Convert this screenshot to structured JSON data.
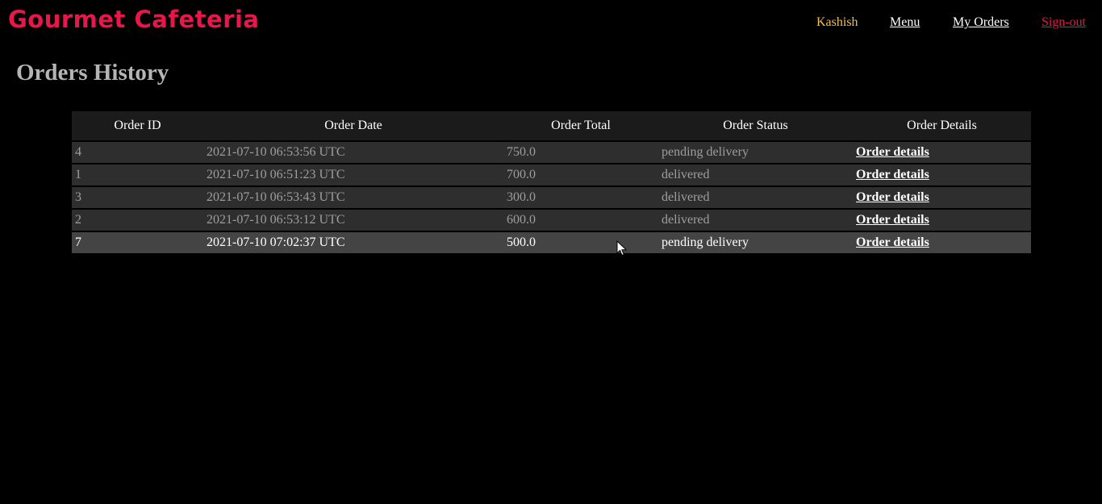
{
  "header": {
    "brand": "Gourmet Cafeteria",
    "nav": {
      "user": "Kashish",
      "menu": "Menu",
      "my_orders": "My Orders",
      "signout": "Sign-out"
    }
  },
  "page": {
    "title": "Orders History"
  },
  "table": {
    "headers": [
      "Order ID",
      "Order Date",
      "Order Total",
      "Order Status",
      "Order Details"
    ],
    "rows": [
      {
        "id": "4",
        "date": "2021-07-10 06:53:56 UTC",
        "total": "750.0",
        "status": "pending delivery",
        "details": "Order details"
      },
      {
        "id": "1",
        "date": "2021-07-10 06:51:23 UTC",
        "total": "700.0",
        "status": "delivered",
        "details": "Order details"
      },
      {
        "id": "3",
        "date": "2021-07-10 06:53:43 UTC",
        "total": "300.0",
        "status": "delivered",
        "details": "Order details"
      },
      {
        "id": "2",
        "date": "2021-07-10 06:53:12 UTC",
        "total": "600.0",
        "status": "delivered",
        "details": "Order details"
      },
      {
        "id": "7",
        "date": "2021-07-10 07:02:37 UTC",
        "total": "500.0",
        "status": "pending delivery",
        "details": "Order details"
      }
    ]
  },
  "colors": {
    "brand": "#e8174a",
    "user": "#f2c14b",
    "signout": "#e8174a",
    "background": "#000000"
  }
}
